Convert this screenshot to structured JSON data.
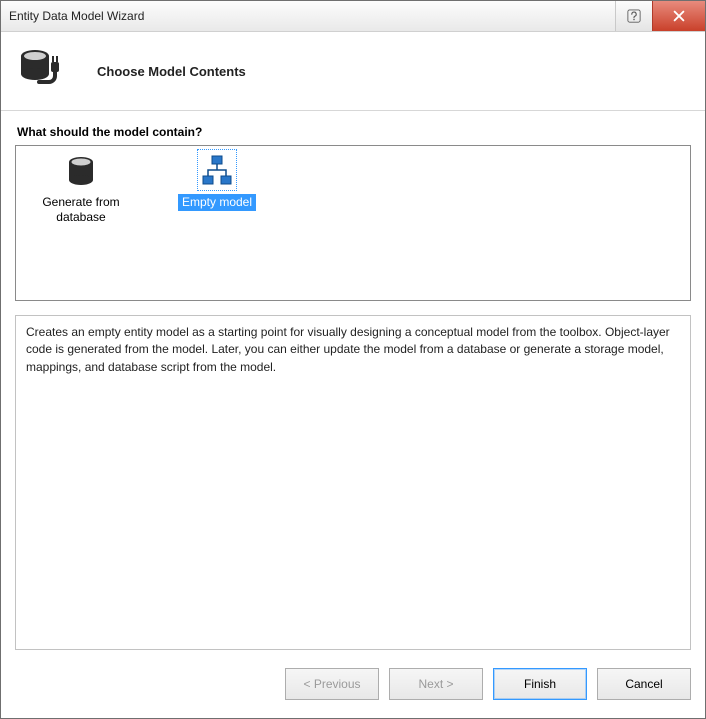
{
  "window": {
    "title": "Entity Data Model Wizard"
  },
  "header": {
    "title": "Choose Model Contents"
  },
  "section": {
    "prompt": "What should the model contain?"
  },
  "options": [
    {
      "label": "Generate from database",
      "selected": false
    },
    {
      "label": "Empty model",
      "selected": true
    }
  ],
  "description": "Creates an empty entity model as a starting point for visually designing a conceptual model from the toolbox. Object-layer code is generated from the model. Later, you can either update the model from a database or generate a storage model, mappings, and database script from the model.",
  "buttons": {
    "previous": "< Previous",
    "next": "Next >",
    "finish": "Finish",
    "cancel": "Cancel"
  }
}
